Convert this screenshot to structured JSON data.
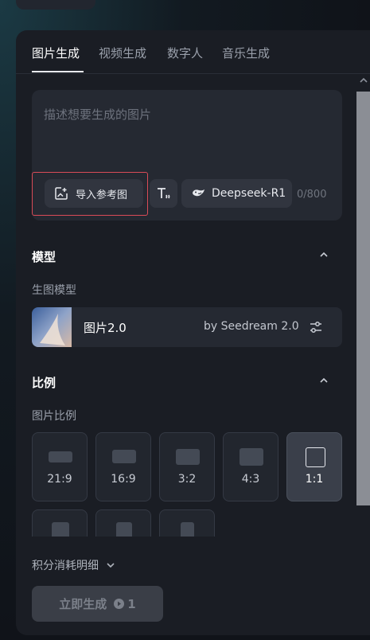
{
  "tabs": [
    {
      "label": "图片生成",
      "active": true
    },
    {
      "label": "视频生成",
      "active": false
    },
    {
      "label": "数字人",
      "active": false
    },
    {
      "label": "音乐生成",
      "active": false
    }
  ],
  "prompt": {
    "placeholder": "描述想要生成的图片",
    "ref_button": "导入参考图",
    "text_icon": "text-style-icon",
    "model_button": "Deepseek-R1",
    "counter": "0/800"
  },
  "model_section": {
    "title": "模型",
    "sub_label": "生图模型",
    "model_name": "图片2.0",
    "model_by": "by Seedream 2.0"
  },
  "ratio_section": {
    "title": "比例",
    "sub_label": "图片比例",
    "ratios": [
      {
        "label": "21:9",
        "selected": false
      },
      {
        "label": "16:9",
        "selected": false
      },
      {
        "label": "3:2",
        "selected": false
      },
      {
        "label": "4:3",
        "selected": false
      },
      {
        "label": "1:1",
        "selected": true
      }
    ]
  },
  "credits_label": "积分消耗明细",
  "generate": {
    "label": "立即生成",
    "cost": "1"
  },
  "colors": {
    "highlight": "#d94b57",
    "panel": "#1a1d24",
    "card": "#252932"
  }
}
